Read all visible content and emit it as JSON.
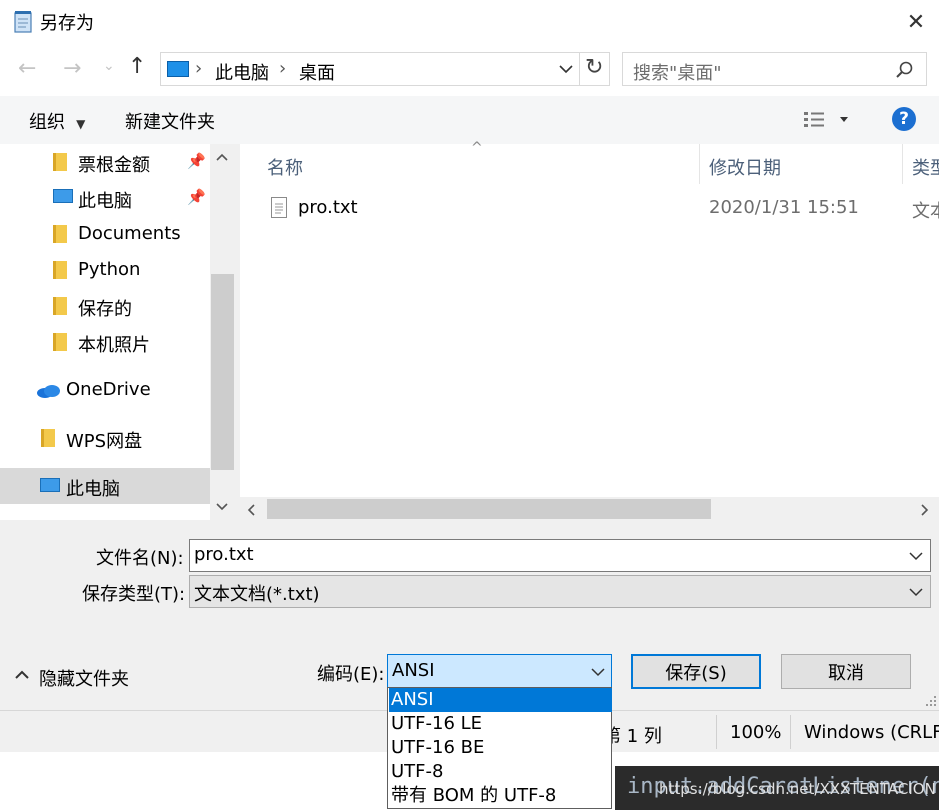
{
  "window": {
    "title": "另存为",
    "close_symbol": "✕"
  },
  "nav": {
    "path": [
      "此电脑",
      "桌面"
    ],
    "separator": "›",
    "search_placeholder": "搜索\"桌面\""
  },
  "toolbar": {
    "organize": "组织",
    "new_folder": "新建文件夹",
    "help_symbol": "?"
  },
  "sidebar": {
    "items": [
      {
        "label": "票根金额",
        "icon": "folder-icon",
        "pinned": true
      },
      {
        "label": "此电脑",
        "icon": "computer-icon",
        "pinned": true
      },
      {
        "label": "Documents",
        "icon": "folder-icon",
        "pinned": false
      },
      {
        "label": "Python",
        "icon": "folder-icon",
        "pinned": false
      },
      {
        "label": "保存的",
        "icon": "folder-icon",
        "pinned": false
      },
      {
        "label": "本机照片",
        "icon": "folder-icon",
        "pinned": false
      },
      {
        "label": "OneDrive",
        "icon": "cloud-icon",
        "pinned": false
      },
      {
        "label": "WPS网盘",
        "icon": "folder-icon",
        "pinned": false
      },
      {
        "label": "此电脑",
        "icon": "computer-icon",
        "pinned": false,
        "selected": true
      }
    ]
  },
  "file_list": {
    "columns": [
      "名称",
      "修改日期",
      "类型"
    ],
    "files": [
      {
        "name": "pro.txt",
        "modified": "2020/1/31 15:51",
        "type": "文本"
      }
    ]
  },
  "form": {
    "filename_label": "文件名(N):",
    "filename_value": "pro.txt",
    "filetype_label": "保存类型(T):",
    "filetype_value": "文本文档(*.txt)",
    "hide_folders": "隐藏文件夹",
    "encoding_label": "编码(E):",
    "encoding_value": "ANSI",
    "save_button": "保存(S)",
    "cancel_button": "取消"
  },
  "encoding_options": [
    "ANSI",
    "UTF-16 LE",
    "UTF-16 BE",
    "UTF-8",
    "带有 BOM 的 UTF-8"
  ],
  "notepad_status": {
    "position": "第 1 列",
    "zoom": "100%",
    "line_ending": "Windows (CRLF)"
  },
  "background_snippet": {
    "url": "https://blog.csdn.net/XXXTENTACION",
    "code": "input.addCaretListener(ne"
  },
  "colors": {
    "selection": "#0078d7",
    "selected_row": "#cce8ff",
    "help_blue": "#1c6fd1",
    "button_focus_border": "#0078d7"
  }
}
